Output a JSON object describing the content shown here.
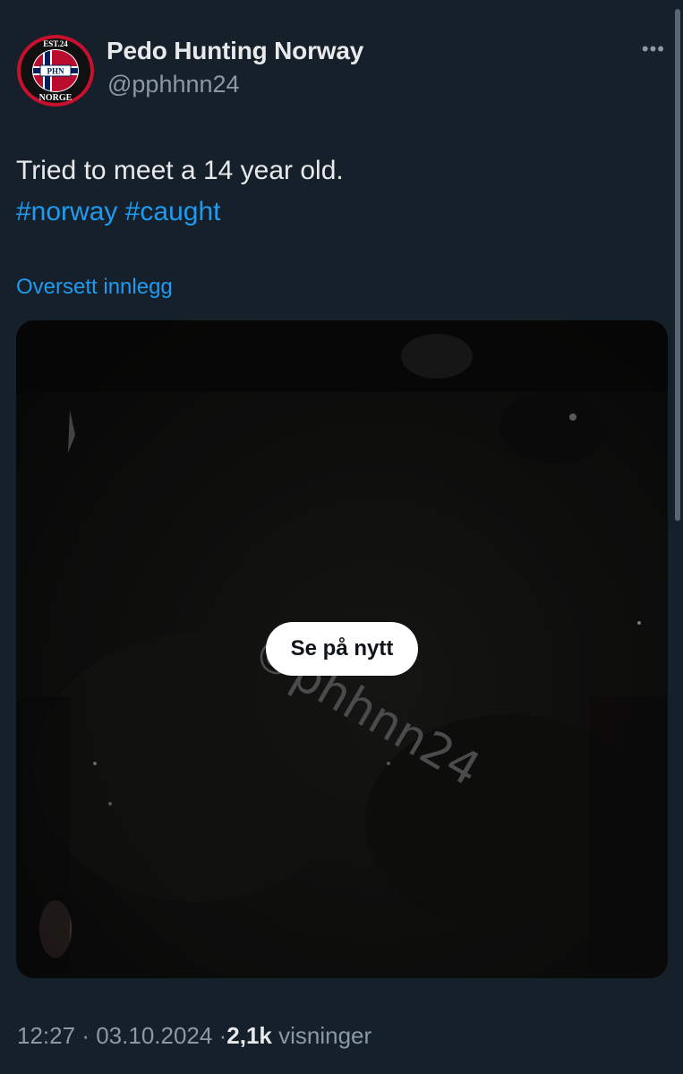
{
  "author": {
    "display_name": "Pedo Hunting Norway",
    "handle": "@pphhnn24",
    "avatar": {
      "top_text": "EST.24",
      "center_text": "PHN",
      "bottom_text": "NORGE",
      "ring_color": "#c8102e",
      "flag_red": "#ba0c2f",
      "flag_blue": "#00205b"
    }
  },
  "menu": {
    "icon": "more-horizontal-icon",
    "label": "•••"
  },
  "tweet": {
    "text": "Tried to meet a 14 year old.",
    "hashtags": [
      "#norway",
      "#caught"
    ]
  },
  "translate_link": "Oversett innlegg",
  "media": {
    "watermark": "©phhnn24",
    "replay_button": "Se på nytt"
  },
  "meta": {
    "time": "12:27",
    "separator": "·",
    "date": "03.10.2024",
    "views_count": "2,1k",
    "views_label": "visninger"
  },
  "colors": {
    "background": "#15202b",
    "text": "#e7e9ea",
    "secondary": "#8b98a5",
    "accent": "#1d9bf0"
  }
}
